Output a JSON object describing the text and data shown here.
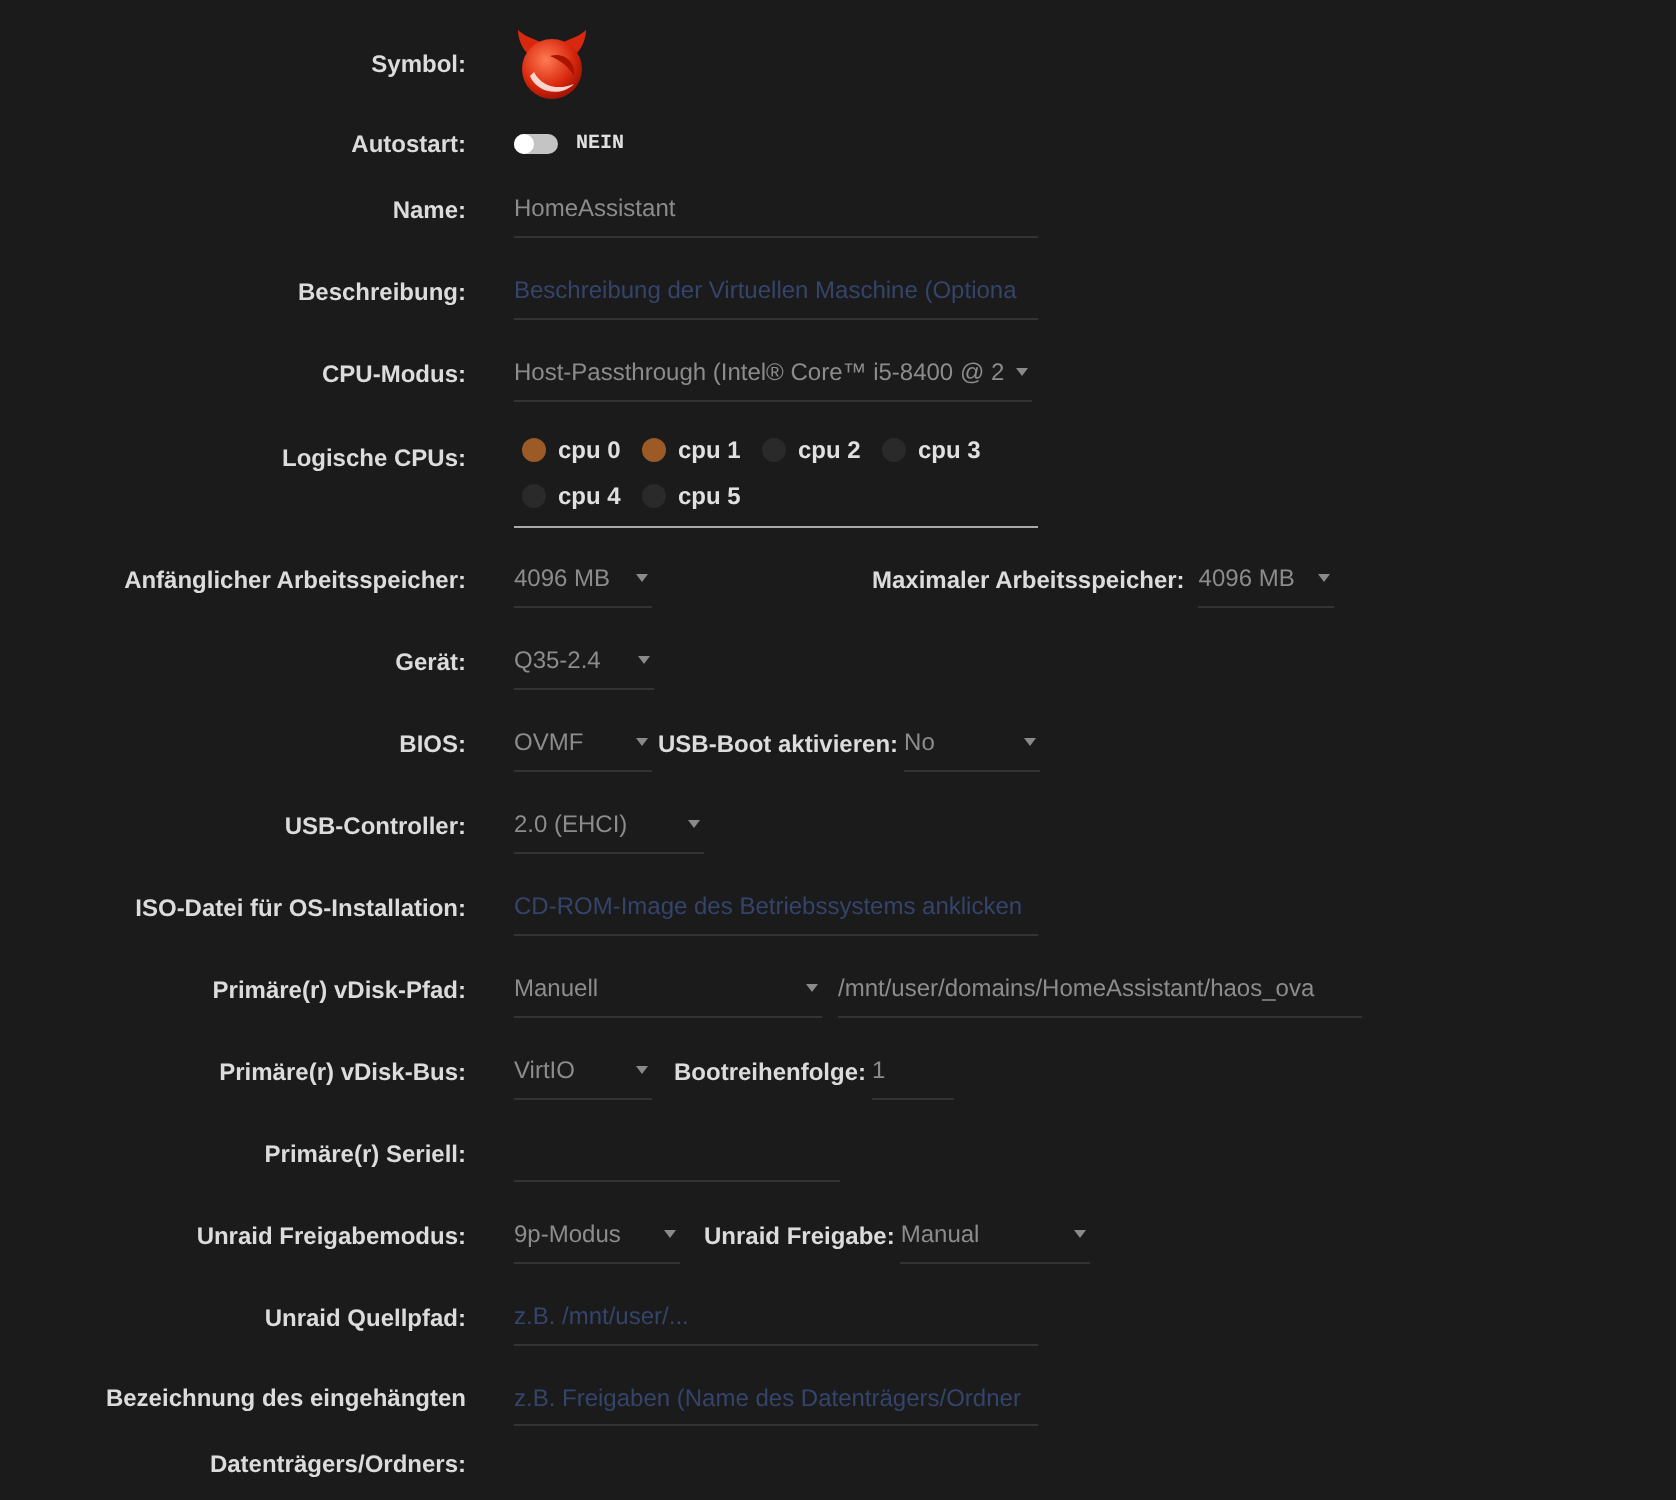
{
  "form": {
    "symbol": {
      "label": "Symbol:"
    },
    "autostart": {
      "label": "Autostart:",
      "on": false,
      "state_text": "NEIN"
    },
    "name": {
      "label": "Name:",
      "value": "HomeAssistant"
    },
    "description": {
      "label": "Beschreibung:",
      "placeholder": "Beschreibung der Virtuellen Maschine (Optiona"
    },
    "cpu_mode": {
      "label": "CPU-Modus:",
      "value": "Host-Passthrough (Intel® Core™ i5-8400 @ 2"
    },
    "logical_cpus": {
      "label": "Logische CPUs:",
      "cpus": [
        {
          "label": "cpu 0",
          "checked": true
        },
        {
          "label": "cpu 1",
          "checked": true
        },
        {
          "label": "cpu 2",
          "checked": false
        },
        {
          "label": "cpu 3",
          "checked": false
        },
        {
          "label": "cpu 4",
          "checked": false
        },
        {
          "label": "cpu 5",
          "checked": false
        }
      ]
    },
    "memory": {
      "initial_label": "Anfänglicher Arbeitsspeicher:",
      "initial_value": "4096 MB",
      "max_label": "Maximaler Arbeitsspeicher:",
      "max_value": "4096 MB"
    },
    "machine": {
      "label": "Gerät:",
      "value": "Q35-2.4"
    },
    "bios": {
      "label": "BIOS:",
      "value": "OVMF",
      "usb_boot_label": "USB-Boot aktivieren:",
      "usb_boot_value": "No"
    },
    "usb_controller": {
      "label": "USB-Controller:",
      "value": "2.0 (EHCI)"
    },
    "iso": {
      "label": "ISO-Datei für OS-Installation:",
      "placeholder": "CD-ROM-Image des Betriebssystems anklicken"
    },
    "vdisk_path": {
      "label": "Primäre(r) vDisk-Pfad:",
      "mode": "Manuell",
      "path": "/mnt/user/domains/HomeAssistant/haos_ova"
    },
    "vdisk_bus": {
      "label": "Primäre(r) vDisk-Bus:",
      "value": "VirtIO",
      "boot_order_label": "Bootreihenfolge:",
      "boot_order": "1"
    },
    "serial": {
      "label": "Primäre(r) Seriell:"
    },
    "share_mode": {
      "label": "Unraid Freigabemodus:",
      "value": "9p-Modus",
      "share_label": "Unraid Freigabe:",
      "share_value": "Manual"
    },
    "source_path": {
      "label": "Unraid Quellpfad:",
      "placeholder": "z.B. /mnt/user/..."
    },
    "mount_tag": {
      "label": "Bezeichnung des eingehängten Datenträgers/Ordners:",
      "placeholder": "z.B. Freigaben (Name des Datenträgers/Ordner"
    }
  }
}
